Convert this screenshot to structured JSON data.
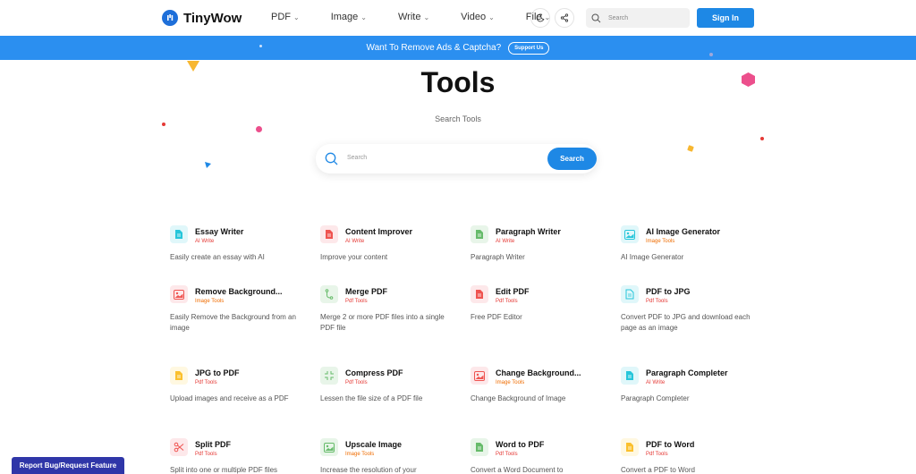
{
  "header": {
    "logo_text": "TinyWow",
    "nav": [
      {
        "label": "PDF"
      },
      {
        "label": "Image"
      },
      {
        "label": "Write"
      },
      {
        "label": "Video"
      },
      {
        "label": "File"
      }
    ],
    "search_placeholder": "Search",
    "signin_label": "Sign In"
  },
  "banner": {
    "text": "Want To Remove Ads & Captcha?",
    "button_label": "Support Us"
  },
  "hero": {
    "title": "Tools",
    "subtitle": "Search Tools",
    "search_placeholder": "Search",
    "search_button": "Search"
  },
  "tools": [
    {
      "name": "Essay Writer",
      "category": "AI Write",
      "description": "Easily create an essay with AI"
    },
    {
      "name": "Content Improver",
      "category": "AI Write",
      "description": "Improve your content"
    },
    {
      "name": "Paragraph Writer",
      "category": "AI Write",
      "description": "Paragraph Writer"
    },
    {
      "name": "AI Image Generator",
      "category": "Image Tools",
      "description": "AI Image Generator"
    },
    {
      "name": "Remove Background...",
      "category": "Image Tools",
      "description": "Easily Remove the Background from an image"
    },
    {
      "name": "Merge PDF",
      "category": "Pdf Tools",
      "description": "Merge 2 or more PDF files into a single PDF file"
    },
    {
      "name": "Edit PDF",
      "category": "Pdf Tools",
      "description": "Free PDF Editor"
    },
    {
      "name": "PDF to JPG",
      "category": "Pdf Tools",
      "description": "Convert PDF to JPG and download each page as an image"
    },
    {
      "name": "JPG to PDF",
      "category": "Pdf Tools",
      "description": "Upload images and receive as a PDF"
    },
    {
      "name": "Compress PDF",
      "category": "Pdf Tools",
      "description": "Lessen the file size of a PDF file"
    },
    {
      "name": "Change Background...",
      "category": "Image Tools",
      "description": "Change Background of Image"
    },
    {
      "name": "Paragraph Completer",
      "category": "AI Write",
      "description": "Paragraph Completer"
    },
    {
      "name": "Split PDF",
      "category": "Pdf Tools",
      "description": "Split into one or multiple PDF files"
    },
    {
      "name": "Upscale Image",
      "category": "Image Tools",
      "description": "Increase the resolution of your"
    },
    {
      "name": "Word to PDF",
      "category": "Pdf Tools",
      "description": "Convert a Word Document to"
    },
    {
      "name": "PDF to Word",
      "category": "Pdf Tools",
      "description": "Convert a PDF to Word"
    }
  ],
  "colors": {
    "primary": "#1e88e5",
    "banner": "#2b8ff0",
    "ai_write": "#e53935",
    "image_tools": "#ef6c00",
    "pdf_tools": "#e53935",
    "report": "#2f36a8"
  },
  "report_label": "Report Bug/Request Feature"
}
